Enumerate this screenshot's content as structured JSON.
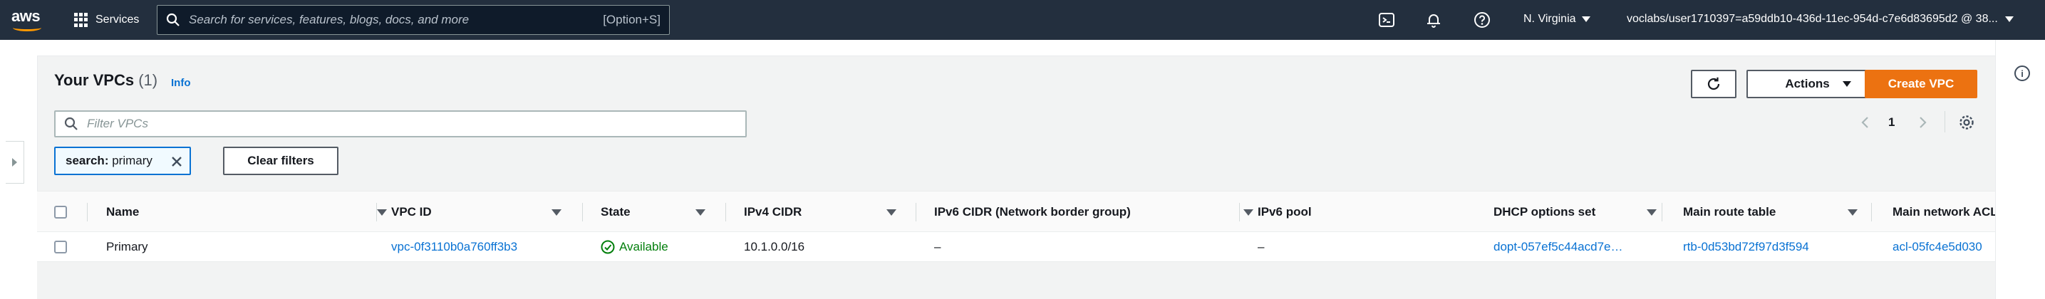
{
  "topnav": {
    "logo": "aws",
    "services_label": "Services",
    "search_placeholder": "Search for services, features, blogs, docs, and more",
    "search_shortcut": "[Option+S]",
    "region": "N. Virginia",
    "account": "voclabs/user1710397=a59ddb10-436d-11ec-954d-c7e6d83695d2 @ 38..."
  },
  "header": {
    "title": "Your VPCs",
    "count": "(1)",
    "info_link": "Info",
    "actions_label": "Actions",
    "create_label": "Create VPC"
  },
  "filter": {
    "placeholder": "Filter VPCs",
    "token_key": "search:",
    "token_value": "primary",
    "clear_label": "Clear filters"
  },
  "pagination": {
    "current_page": "1"
  },
  "table": {
    "columns": [
      "Name",
      "VPC ID",
      "State",
      "IPv4 CIDR",
      "IPv6 CIDR (Network border group)",
      "IPv6 pool",
      "DHCP options set",
      "Main route table",
      "Main network ACL"
    ],
    "rows": [
      {
        "name": "Primary",
        "vpc_id": "vpc-0f3110b0a760ff3b3",
        "state": "Available",
        "ipv4_cidr": "10.1.0.0/16",
        "ipv6_cidr": "–",
        "ipv6_pool": "–",
        "dhcp_options_set": "dopt-057ef5c44acd7e…",
        "main_route_table": "rtb-0d53bd72f97d3f594",
        "main_network_acl": "acl-05fc4e5d030"
      }
    ]
  },
  "colors": {
    "nav_bg": "#232f3e",
    "primary_button": "#ec7211",
    "link": "#0972d3",
    "status_ok": "#037f0c",
    "page_bg": "#f2f3f3"
  },
  "icons": [
    "aws-logo",
    "services-grid-icon",
    "search-icon",
    "cloudshell-icon",
    "notifications-bell-icon",
    "help-icon",
    "refresh-icon",
    "filter-search-icon",
    "chevron-left-icon",
    "chevron-right-icon",
    "settings-gear-icon",
    "close-icon",
    "status-check-icon",
    "info-icon"
  ]
}
